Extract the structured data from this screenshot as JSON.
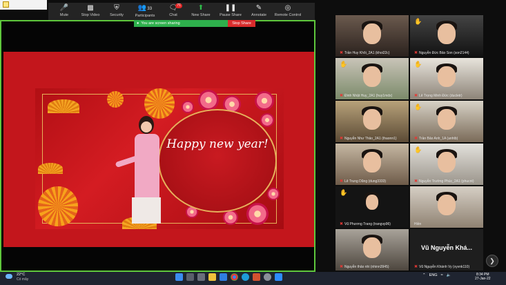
{
  "toolbar": {
    "items": [
      {
        "label": "Mute",
        "icon": "mic-icon"
      },
      {
        "label": "Stop Video",
        "icon": "video-icon"
      },
      {
        "label": "Security",
        "icon": "shield-icon"
      },
      {
        "label": "Participants",
        "icon": "participants-icon",
        "count": "33"
      },
      {
        "label": "Chat",
        "icon": "chat-icon",
        "badge": "71"
      },
      {
        "label": "New Share",
        "icon": "share-icon"
      },
      {
        "label": "Pause Share",
        "icon": "pause-icon"
      },
      {
        "label": "Annotate",
        "icon": "pen-icon"
      },
      {
        "label": "Remote Control",
        "icon": "remote-control-icon"
      }
    ]
  },
  "share_banner": {
    "status": "You are screen sharing",
    "stop_label": "Stop Share"
  },
  "slide": {
    "greeting": "Happy new year!"
  },
  "gallery": {
    "tiles": [
      {
        "name": "Trần Huy Khôi_2A1 (khoi22c)",
        "hand": false
      },
      {
        "name": "Nguyễn Đức Bảo Son (son2144)",
        "hand": true
      },
      {
        "name": "Đinh Nhật Huy_2A1 (huy1mdx)",
        "hand": true
      },
      {
        "name": "Lê Trọng Minh Đức (ducletr)",
        "hand": true
      },
      {
        "name": "Nguyễn Như Thảo_2A1 (thaonn1)",
        "hand": false
      },
      {
        "name": "Trần Bảo Anh_1A (anhtb)",
        "hand": true
      },
      {
        "name": "Lê Trung Dũng (dung3333)",
        "hand": false
      },
      {
        "name": "Nguyễn Trường Phúc_2A1 (phucnt)",
        "hand": true
      },
      {
        "name": "Vũ Phương Trang (trangvp96)",
        "hand": true
      },
      {
        "name": "Hiền",
        "hand": false
      },
      {
        "name": "Nguyễn thảo nhi (nhinn3945)",
        "hand": false
      },
      {
        "name": "Vũ Nguyễn Khánh Vy (vyvnk110)",
        "hand": false,
        "display": "Vũ Nguyễn Khá..."
      }
    ]
  },
  "taskbar": {
    "weather_temp": "22°C",
    "weather_text": "Có mây",
    "language": "ENG",
    "time": "8:34 PM",
    "date": "27-Jan-22"
  },
  "colors": {
    "toolbar_bg": "#242424",
    "share_green": "#2eb04c",
    "stop_red": "#d92c2c",
    "slide_red": "#c3161c",
    "border_green": "#5fc83c"
  }
}
